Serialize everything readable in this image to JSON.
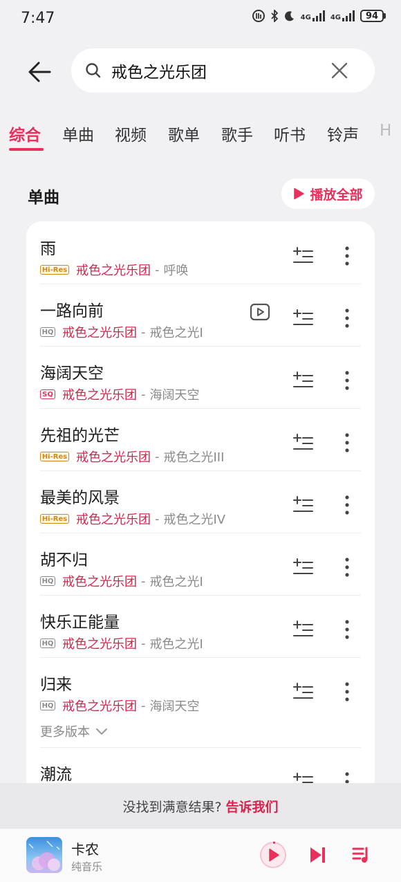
{
  "status_bar": {
    "time": "7:47",
    "network_1": "4G",
    "network_2": "4G",
    "battery": "94"
  },
  "search": {
    "query": "戒色之光乐团",
    "icons": [
      "back-arrow-icon",
      "search-icon",
      "close-icon"
    ]
  },
  "tabs": [
    {
      "label": "综合",
      "active": true
    },
    {
      "label": "单曲"
    },
    {
      "label": "视频"
    },
    {
      "label": "歌单"
    },
    {
      "label": "歌手"
    },
    {
      "label": "听书"
    },
    {
      "label": "铃声"
    },
    {
      "label": "H"
    }
  ],
  "section": {
    "title": "单曲",
    "play_all_label": "播放全部"
  },
  "songs": [
    {
      "title": "雨",
      "quality": "Hi-Res",
      "artist": "戒色之光乐团",
      "sep": "-",
      "album": "呼唤",
      "has_mv": false
    },
    {
      "title": "一路向前",
      "quality": "HQ",
      "artist": "戒色之光乐团",
      "sep": "-",
      "album": "戒色之光I",
      "has_mv": true
    },
    {
      "title": "海阔天空",
      "quality": "SQ",
      "artist": "戒色之光乐团",
      "sep": "-",
      "album": "海阔天空",
      "has_mv": false
    },
    {
      "title": "先祖的光芒",
      "quality": "Hi-Res",
      "artist": "戒色之光乐团",
      "sep": "-",
      "album": "戒色之光III",
      "has_mv": false
    },
    {
      "title": "最美的风景",
      "quality": "Hi-Res",
      "artist": "戒色之光乐团",
      "sep": "-",
      "album": "戒色之光IV",
      "has_mv": false
    },
    {
      "title": "胡不归",
      "quality": "HQ",
      "artist": "戒色之光乐团",
      "sep": "-",
      "album": "戒色之光I",
      "has_mv": false
    },
    {
      "title": "快乐正能量",
      "quality": "HQ",
      "artist": "戒色之光乐团",
      "sep": "-",
      "album": "戒色之光I",
      "has_mv": false
    },
    {
      "title": "归来",
      "quality": "HQ",
      "artist": "戒色之光乐团",
      "sep": "-",
      "album": "海阔天空",
      "has_mv": false
    },
    {
      "title": "潮流"
    }
  ],
  "more_versions_label": "更多版本",
  "feedback": {
    "text": "没找到满意结果?",
    "link": "告诉我们"
  },
  "player": {
    "title": "卡农",
    "subtitle": "纯音乐"
  },
  "colors": {
    "accent": "#e8305a",
    "artist": "#d8234f",
    "background": "#f1f1f3",
    "hires_badge": "#d08a19"
  }
}
